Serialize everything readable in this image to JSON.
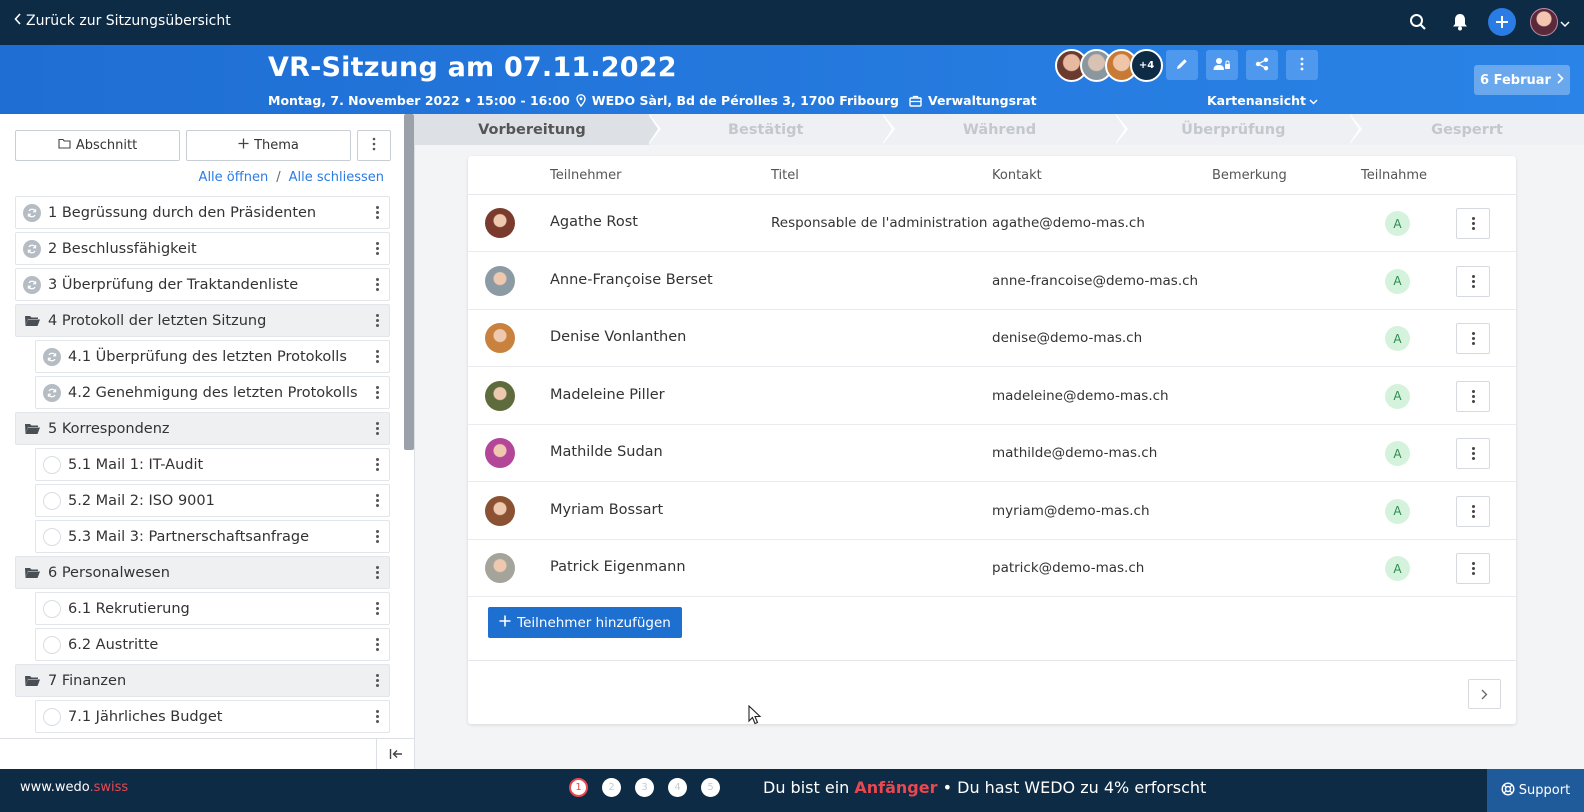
{
  "topbar": {
    "back_label": "Zurück zur Sitzungsübersicht"
  },
  "header": {
    "title": "VR-Sitzung am 07.11.2022",
    "datetime": "Montag, 7. November 2022 • 15:00 - 16:00",
    "location": "WEDO Sàrl, Bd de Pérolles 3, 1700 Fribourg",
    "committee": "Verwaltungsrat",
    "more_participants": "+4",
    "view_label": "Kartenansicht",
    "next_date_label": "6 Februar"
  },
  "sidebar": {
    "section_button": "Abschnitt",
    "topic_button": "Thema",
    "open_all": "Alle öffnen",
    "separator": "/",
    "close_all": "Alle schliessen",
    "items": [
      {
        "label": "1 Begrüssung durch den Präsidenten",
        "type": "sync"
      },
      {
        "label": "2 Beschlussfähigkeit",
        "type": "sync"
      },
      {
        "label": "3 Überprüfung der Traktandenliste",
        "type": "sync"
      },
      {
        "label": "4 Protokoll der letzten Sitzung",
        "type": "folder"
      },
      {
        "label": "4.1 Überprüfung des letzten Protokolls",
        "type": "sub-sync"
      },
      {
        "label": "4.2 Genehmigung des letzten Protokolls",
        "type": "sub-sync"
      },
      {
        "label": "5 Korrespondenz",
        "type": "folder"
      },
      {
        "label": "5.1 Mail 1: IT-Audit",
        "type": "sub"
      },
      {
        "label": "5.2 Mail 2: ISO 9001",
        "type": "sub"
      },
      {
        "label": "5.3 Mail 3: Partnerschaftsanfrage",
        "type": "sub"
      },
      {
        "label": "6 Personalwesen",
        "type": "folder"
      },
      {
        "label": "6.1 Rekrutierung",
        "type": "sub"
      },
      {
        "label": "6.2 Austritte",
        "type": "sub"
      },
      {
        "label": "7 Finanzen",
        "type": "folder"
      },
      {
        "label": "7.1 Jährliches Budget",
        "type": "sub"
      }
    ]
  },
  "steps": [
    "Vorbereitung",
    "Bestätigt",
    "Während",
    "Überprüfung",
    "Gesperrt"
  ],
  "table": {
    "headers": {
      "participant": "Teilnehmer",
      "title": "Titel",
      "contact": "Kontakt",
      "remark": "Bemerkung",
      "attendance": "Teilnahme"
    },
    "rows": [
      {
        "name": "Agathe Rost",
        "title": "Responsable de l'administration",
        "contact": "agathe@demo-mas.ch",
        "status": "A",
        "avatar_color": "#7a3b2e"
      },
      {
        "name": "Anne-Françoise Berset",
        "title": "",
        "contact": "anne-francoise@demo-mas.ch",
        "status": "A",
        "avatar_color": "#8c9aa3"
      },
      {
        "name": "Denise Vonlanthen",
        "title": "",
        "contact": "denise@demo-mas.ch",
        "status": "A",
        "avatar_color": "#c8823e"
      },
      {
        "name": "Madeleine Piller",
        "title": "",
        "contact": "madeleine@demo-mas.ch",
        "status": "A",
        "avatar_color": "#5e6b3c"
      },
      {
        "name": "Mathilde Sudan",
        "title": "",
        "contact": "mathilde@demo-mas.ch",
        "status": "A",
        "avatar_color": "#b4469a"
      },
      {
        "name": "Myriam Bossart",
        "title": "",
        "contact": "myriam@demo-mas.ch",
        "status": "A",
        "avatar_color": "#8a5232"
      },
      {
        "name": "Patrick Eigenmann",
        "title": "",
        "contact": "patrick@demo-mas.ch",
        "status": "A",
        "avatar_color": "#a5a49a"
      }
    ],
    "add_label": "Teilnehmer hinzufügen"
  },
  "footer": {
    "brand_main": "www.wedo",
    "brand_tld": ".swiss",
    "dots": [
      "1",
      "2",
      "3",
      "4",
      "5"
    ],
    "level_prefix": "Du bist ein",
    "level": "Anfänger",
    "level_suffix": "• Du hast WEDO zu 4% erforscht",
    "support_label": "Support"
  },
  "colors": {
    "navy": "#0d2b45",
    "header_blue": "#1f6ed4",
    "primary": "#1d6fd0",
    "accent_red": "#e8484f",
    "badge_green": "#d4f2dc"
  }
}
